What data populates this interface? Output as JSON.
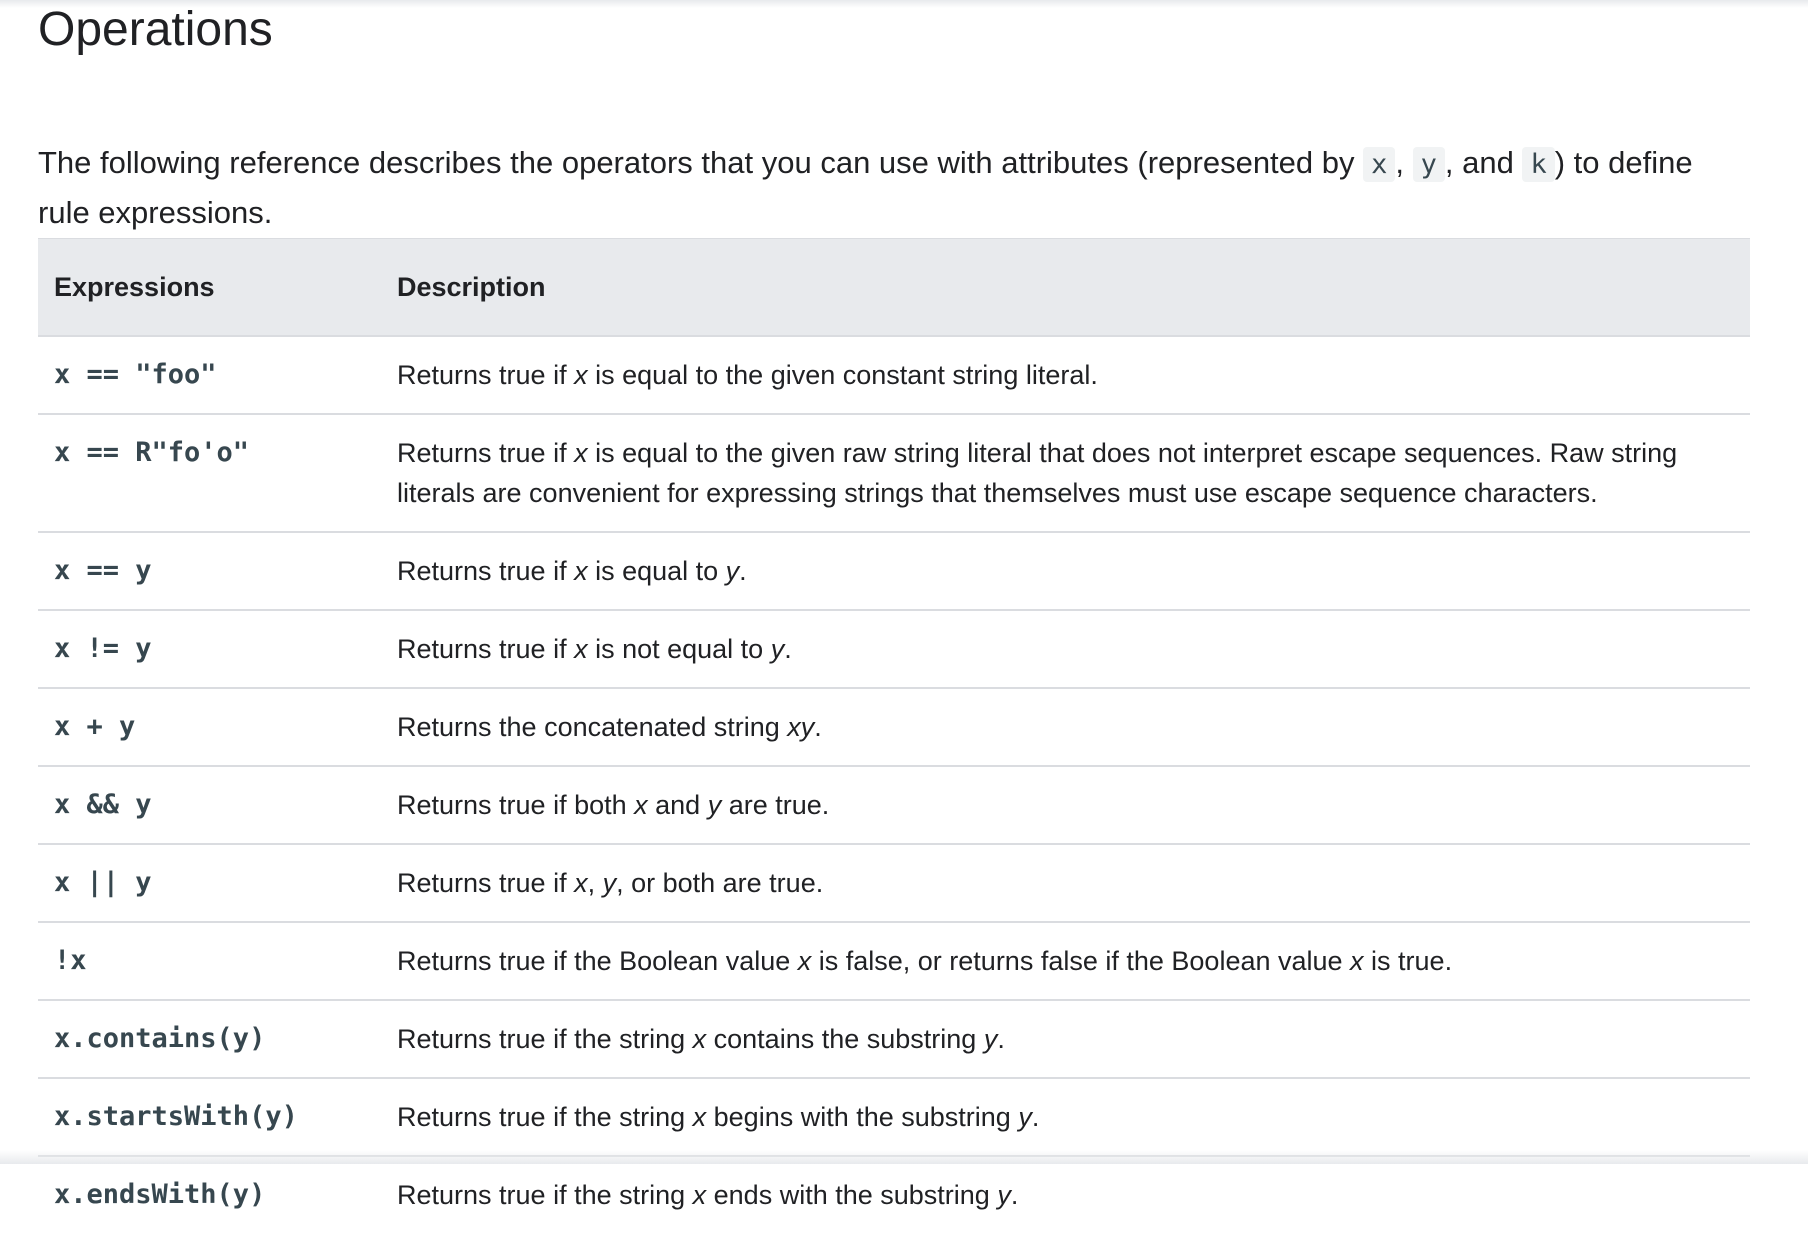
{
  "page": {
    "title": "Operations",
    "intro": {
      "before": "The following reference describes the operators that you can use with attributes (represented by ",
      "code_x": "x",
      "sep1": ", ",
      "code_y": "y",
      "sep2": ", and ",
      "code_k": "k",
      "after": ") to define rule expressions."
    }
  },
  "table": {
    "headers": {
      "expressions": "Expressions",
      "description": "Description"
    },
    "rows": [
      {
        "expr": "x == \"foo\"",
        "desc": [
          {
            "t": "Returns true if "
          },
          {
            "t": "x",
            "i": true
          },
          {
            "t": " is equal to the given constant string literal."
          }
        ]
      },
      {
        "expr": "x == R\"fo'o\"",
        "desc": [
          {
            "t": "Returns true if "
          },
          {
            "t": "x",
            "i": true
          },
          {
            "t": " is equal to the given raw string literal that does not interpret escape sequences. Raw string literals are convenient for expressing strings that themselves must use escape sequence characters."
          }
        ]
      },
      {
        "expr": "x == y",
        "desc": [
          {
            "t": "Returns true if "
          },
          {
            "t": "x",
            "i": true
          },
          {
            "t": " is equal to "
          },
          {
            "t": "y",
            "i": true
          },
          {
            "t": "."
          }
        ]
      },
      {
        "expr": "x != y",
        "desc": [
          {
            "t": "Returns true if "
          },
          {
            "t": "x",
            "i": true
          },
          {
            "t": " is not equal to "
          },
          {
            "t": "y",
            "i": true
          },
          {
            "t": "."
          }
        ]
      },
      {
        "expr": "x + y",
        "desc": [
          {
            "t": "Returns the concatenated string "
          },
          {
            "t": "xy",
            "i": true
          },
          {
            "t": "."
          }
        ]
      },
      {
        "expr": "x && y",
        "desc": [
          {
            "t": "Returns true if both "
          },
          {
            "t": "x",
            "i": true
          },
          {
            "t": " and "
          },
          {
            "t": "y",
            "i": true
          },
          {
            "t": " are true."
          }
        ]
      },
      {
        "expr": "x || y",
        "desc": [
          {
            "t": "Returns true if "
          },
          {
            "t": "x",
            "i": true
          },
          {
            "t": ", "
          },
          {
            "t": "y",
            "i": true
          },
          {
            "t": ", or both are true."
          }
        ]
      },
      {
        "expr": "!x",
        "desc": [
          {
            "t": "Returns true if the Boolean value "
          },
          {
            "t": "x",
            "i": true
          },
          {
            "t": " is false, or returns false if the Boolean value "
          },
          {
            "t": "x",
            "i": true
          },
          {
            "t": " is true."
          }
        ]
      },
      {
        "expr": "x.contains(y)",
        "desc": [
          {
            "t": "Returns true if the string "
          },
          {
            "t": "x",
            "i": true
          },
          {
            "t": " contains the substring "
          },
          {
            "t": "y",
            "i": true
          },
          {
            "t": "."
          }
        ]
      },
      {
        "expr": "x.startsWith(y)",
        "desc": [
          {
            "t": "Returns true if the string "
          },
          {
            "t": "x",
            "i": true
          },
          {
            "t": " begins with the substring "
          },
          {
            "t": "y",
            "i": true
          },
          {
            "t": "."
          }
        ]
      },
      {
        "expr": "x.endsWith(y)",
        "desc": [
          {
            "t": "Returns true if the string "
          },
          {
            "t": "x",
            "i": true
          },
          {
            "t": " ends with the substring "
          },
          {
            "t": "y",
            "i": true
          },
          {
            "t": "."
          }
        ]
      }
    ]
  }
}
